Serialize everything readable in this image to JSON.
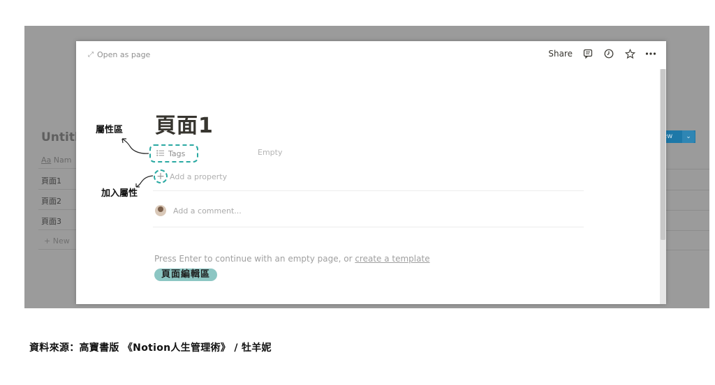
{
  "background": {
    "db_title": "Untitle",
    "name_header_icon": "Aa",
    "name_header": "Nam",
    "rows": [
      "頁面1",
      "頁面2",
      "頁面3"
    ],
    "new_row": "+ New",
    "new_button": "ew",
    "new_caret": "⌄"
  },
  "modal": {
    "open_as_page": "Open as page",
    "share": "Share",
    "page_title": "頁面1",
    "property": {
      "name": "Tags",
      "value": "Empty"
    },
    "add_property": "Add a property",
    "comment_placeholder": "Add a comment...",
    "press_enter_prefix": "Press Enter to continue with an empty page, or ",
    "press_enter_link": "create a template",
    "editor_label": "頁面編輯區"
  },
  "annotations": {
    "property_area": "屬性區",
    "add_property": "加入屬性"
  },
  "caption": "資料來源：高寶書版 《Notion人生管理術》 / 牡羊妮",
  "colors": {
    "accent_teal": "#2aa9a2",
    "highlight": "#8cc6c3",
    "overlay": "#9b9b9b",
    "new_button": "#1d78a8"
  }
}
